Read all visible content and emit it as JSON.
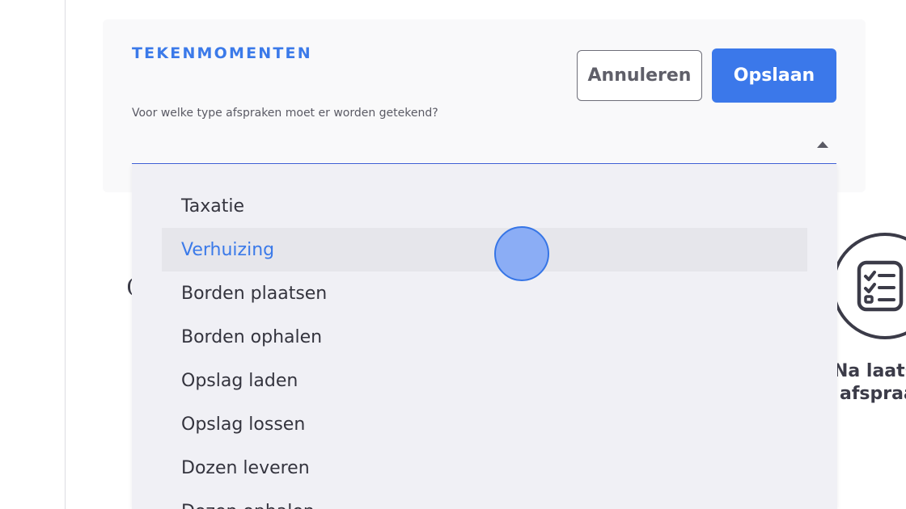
{
  "section": {
    "title": "TEKENMOMENTEN"
  },
  "buttons": {
    "cancel_label": "Annuleren",
    "save_label": "Opslaan"
  },
  "field": {
    "label": "Voor welke type afspraken moet er worden getekend?",
    "value": ""
  },
  "dropdown": {
    "options": [
      "Taxatie",
      "Verhuizing",
      "Borden plaatsen",
      "Borden ophalen",
      "Opslag laden",
      "Opslag lossen",
      "Dozen leveren",
      "Dozen ophalen"
    ],
    "highlighted_index": 1
  },
  "side_card": {
    "icon": "checklist-icon",
    "caption_line1": "Na laats",
    "caption_line2": "afspraa"
  },
  "colors": {
    "accent": "#3b7ae9",
    "button_primary": "#3b78ea",
    "dropdown_bg": "#f0f0f5",
    "highlight_bg": "#e6e6eb"
  }
}
